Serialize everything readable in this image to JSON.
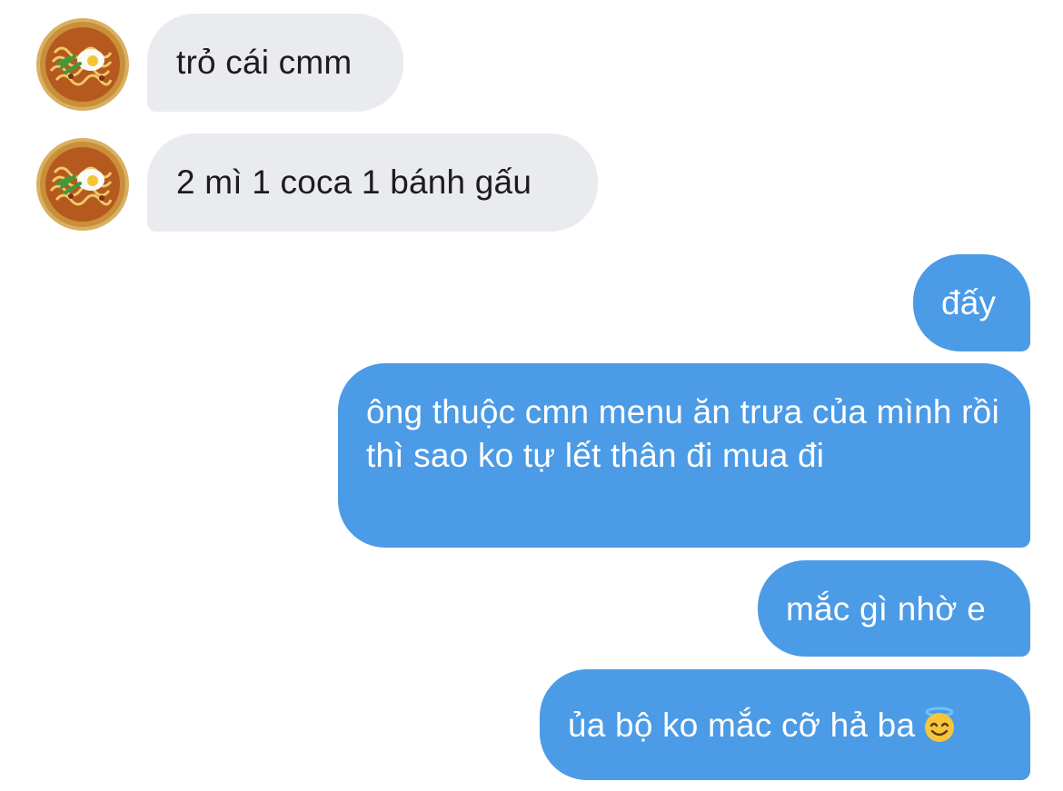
{
  "conversation": {
    "received": [
      {
        "text": "trỏ cái cmm"
      },
      {
        "text": "2 mì 1 coca 1 bánh gấu"
      }
    ],
    "sent": [
      {
        "text": "đấy"
      },
      {
        "text": "ông thuộc cmn menu ăn trưa của mình rồi thì sao ko tự lết thân đi mua đi"
      },
      {
        "text": "mắc gì nhờ e"
      },
      {
        "text": "ủa bộ ko mắc cỡ hả ba",
        "emoji": "smiling-face-with-halo-emoji"
      }
    ]
  },
  "colors": {
    "received_bubble": "#e9ebef",
    "received_text": "#1c1c1e",
    "sent_bubble": "#4b9be6",
    "sent_text": "#ffffff"
  },
  "avatar": {
    "icon": "ramen-bowl-icon"
  }
}
